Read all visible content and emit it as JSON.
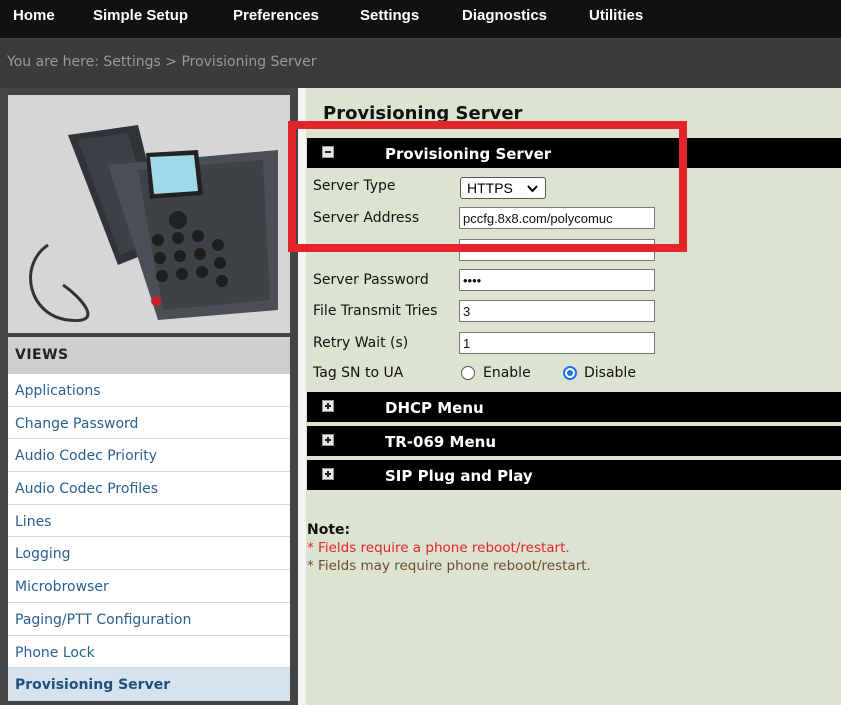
{
  "topnav": [
    "Home",
    "Simple Setup",
    "Preferences",
    "Settings",
    "Diagnostics",
    "Utilities"
  ],
  "breadcrumb": "You are here: Settings > Provisioning Server",
  "sidebar": {
    "views_title": "VIEWS",
    "items": [
      {
        "label": "Applications",
        "active": false
      },
      {
        "label": "Change Password",
        "active": false
      },
      {
        "label": "Audio Codec Priority",
        "active": false
      },
      {
        "label": "Audio Codec Profiles",
        "active": false
      },
      {
        "label": "Lines",
        "active": false
      },
      {
        "label": "Logging",
        "active": false
      },
      {
        "label": "Microbrowser",
        "active": false
      },
      {
        "label": "Paging/PTT Configuration",
        "active": false
      },
      {
        "label": "Phone Lock",
        "active": false
      },
      {
        "label": "Provisioning Server",
        "active": true
      }
    ]
  },
  "page_title": "Provisioning Server",
  "section": {
    "title": "Provisioning Server",
    "expanded": true,
    "fields": {
      "server_type": {
        "label": "Server Type",
        "value": "HTTPS"
      },
      "server_address": {
        "label": "Server Address",
        "value": "pccfg.8x8.com/polycomuc"
      },
      "server_user": {
        "label": "",
        "value": ""
      },
      "server_password": {
        "label": "Server Password",
        "value": "••••"
      },
      "file_transmit_tries": {
        "label": "File Transmit Tries",
        "value": "3"
      },
      "retry_wait": {
        "label": "Retry Wait (s)",
        "value": "1"
      },
      "tag_sn": {
        "label": "Tag SN to UA",
        "enable_label": "Enable",
        "disable_label": "Disable",
        "selected": "Disable"
      }
    }
  },
  "collapsed_sections": [
    "DHCP Menu",
    "TR-069 Menu",
    "SIP Plug and Play"
  ],
  "note": {
    "title": "Note:",
    "reboot_required": "* Fields require a phone reboot/restart.",
    "reboot_may_require": "* Fields may require phone reboot/restart."
  },
  "colors": {
    "highlight_box": "#e3242b",
    "reboot_required": "#e3242b",
    "reboot_may_require": "#6b4d2e",
    "link": "#2a5f8f"
  }
}
